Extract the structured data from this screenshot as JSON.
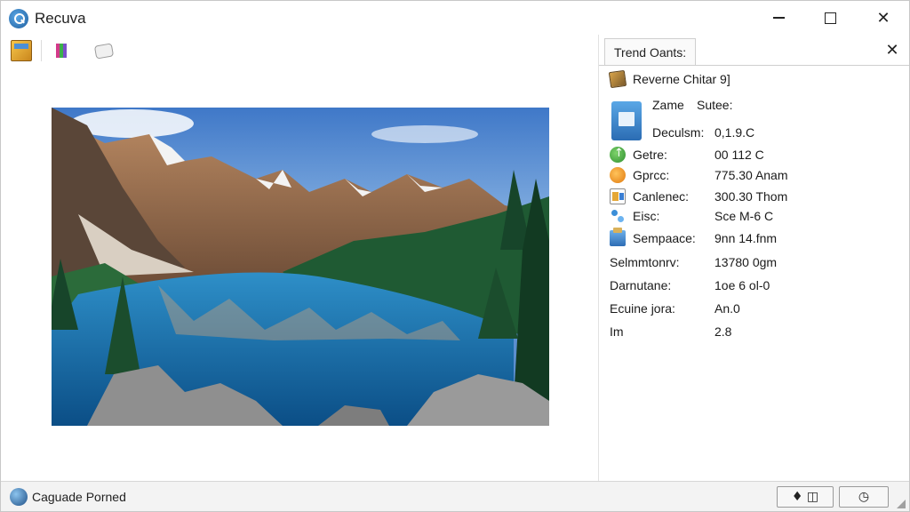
{
  "window": {
    "title": "Recuva",
    "controls": {
      "minimize": "minimize",
      "maximize": "maximize",
      "close": "close"
    }
  },
  "toolbar": {
    "icons": [
      "box-icon",
      "books-icon",
      "chat-icon"
    ]
  },
  "panel": {
    "tab_label": "Trend Oants:",
    "close_glyph": "✕",
    "header": "Reverne Chitar 9]",
    "rows": [
      {
        "label": "Zame",
        "value": "Sutee:",
        "icon": "doc-icon"
      },
      {
        "label": "Deculsm:",
        "value": "0,1.9.C",
        "icon": "doc-icon"
      },
      {
        "label": "Getre:",
        "value": "00 112 C",
        "icon": "green-arrow-icon"
      },
      {
        "label": "Gprcc:",
        "value": "775.30 Anam",
        "icon": "orange-circle-icon"
      },
      {
        "label": "Canlenec:",
        "value": "300.30 Thom",
        "icon": "card-icon"
      },
      {
        "label": "Eisc:",
        "value": "Sce M-6 C",
        "icon": "share-icon"
      },
      {
        "label": "Sempaace:",
        "value": "9nn 14.fnm",
        "icon": "package-icon"
      },
      {
        "label": "Selmmtonrv:",
        "value": "13780 0gm",
        "icon": ""
      },
      {
        "label": "Darnutane:",
        "value": "1oe 6 ol-0",
        "icon": ""
      },
      {
        "label": "Ecuine jora:",
        "value": "An.0",
        "icon": ""
      },
      {
        "label": "Im",
        "value": "2.8",
        "icon": ""
      }
    ]
  },
  "statusbar": {
    "text": "Caguade Porned",
    "button_1": "♦ ◫",
    "button_2": "◷"
  },
  "colors": {
    "accent": "#2b6cb3",
    "panel_border": "#cfcfcf",
    "status_bg": "#f3f3f3"
  }
}
